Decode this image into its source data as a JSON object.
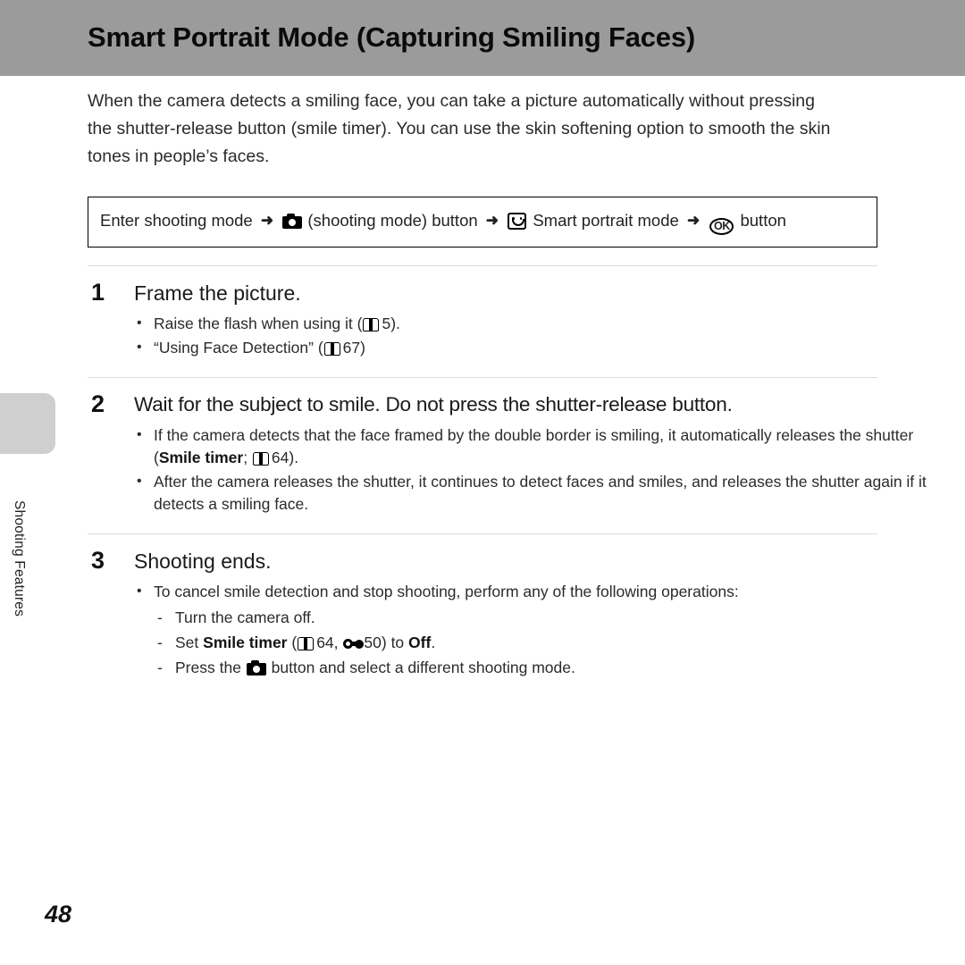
{
  "document": {
    "page_number": "48",
    "side_tab_label": "Shooting Features"
  },
  "header": {
    "title": "Smart Portrait Mode (Capturing Smiling Faces)",
    "band_color": "#9b9b9b"
  },
  "intro": {
    "text": "When the camera detects a smiling face, you can take a picture automatically without pressing the shutter-release button (smile timer). You can use the skin softening option to smooth the skin tones in people’s faces."
  },
  "nav_box": {
    "part1": "Enter shooting mode",
    "arrow": "➜",
    "camera_icon": "camera-icon",
    "part2": "(shooting mode) button",
    "smile_icon": "smart-portrait-icon",
    "part3": "Smart portrait mode",
    "ok_icon": "ok-button-icon",
    "ok_label": "OK",
    "part4": "button"
  },
  "steps": [
    {
      "number": "1",
      "title": "Frame the picture.",
      "bullets": [
        {
          "pre": "Raise the flash when using it (",
          "ref_icon": "book-icon",
          "ref_page": "5",
          "post": ")."
        },
        {
          "pre": "“Using Face Detection” (",
          "ref_icon": "book-icon",
          "ref_page": "67",
          "post": ")"
        }
      ]
    },
    {
      "number": "2",
      "title": "Wait for the subject to smile. Do not press the shutter-release button.",
      "bullets": [
        {
          "pre": "If the camera detects that the face framed by the double border is smiling, it automatically releases the shutter (",
          "bold": "Smile timer",
          "mid": "; ",
          "ref_icon": "book-icon",
          "ref_page": "64",
          "post": ")."
        },
        {
          "pre": "After the camera releases the shutter, it continues to detect faces and smiles, and releases the shutter again if it detects a smiling face."
        }
      ]
    },
    {
      "number": "3",
      "title": "Shooting ends.",
      "bullets": [
        {
          "pre": "To cancel smile detection and stop shooting, perform any of the following operations:"
        }
      ],
      "subitems": [
        {
          "text": "Turn the camera off."
        },
        {
          "pre": "Set ",
          "bold": "Smile timer",
          "mid": " (",
          "ref_icon": "book-icon",
          "ref_page": "64",
          "sep": ", ",
          "ref2_icon": "reference-section-icon",
          "ref2_page": "50",
          "mid2": ") to ",
          "bold2": "Off",
          "post": "."
        },
        {
          "pre": "Press the ",
          "camera_icon": "camera-icon",
          "post": " button and select a different shooting mode."
        }
      ]
    }
  ]
}
